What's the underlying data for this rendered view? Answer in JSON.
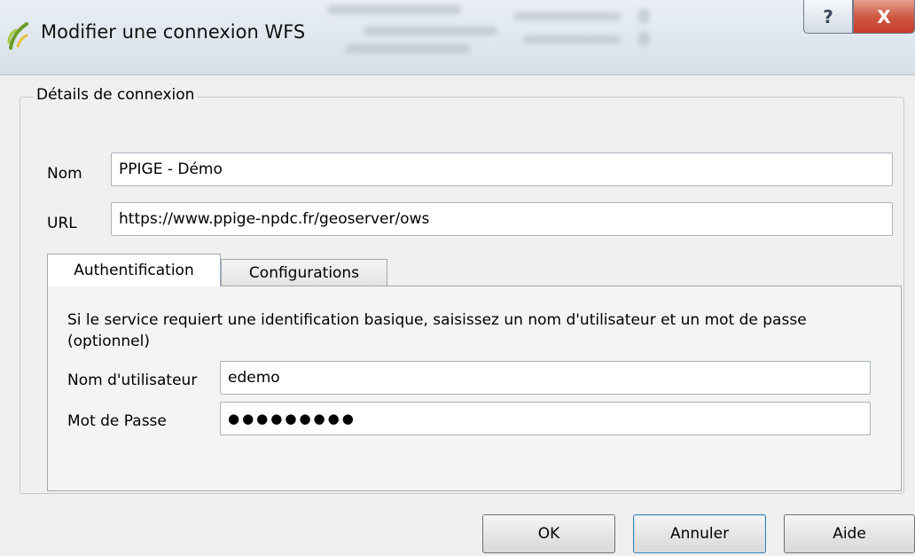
{
  "window": {
    "title": "Modifier une connexion WFS",
    "help_label": "?",
    "close_label": "X"
  },
  "group": {
    "title": "Détails de connexion",
    "name_label": "Nom",
    "name_value": "PPIGE - Démo",
    "url_label": "URL",
    "url_value": "https://www.ppige-npdc.fr/geoserver/ows"
  },
  "tabs": [
    {
      "label": "Authentification",
      "active": true
    },
    {
      "label": "Configurations",
      "active": false
    }
  ],
  "auth": {
    "description": "Si le service requiert une identification basique, saisissez un nom d'utilisateur et un mot de passe (optionnel)",
    "username_label": "Nom d'utilisateur",
    "username_value": "edemo",
    "password_label": "Mot de Passe",
    "password_masked": "●●●●●●●●●"
  },
  "buttons": {
    "ok": "OK",
    "cancel": "Annuler",
    "help": "Aide"
  },
  "colors": {
    "titlebar": "#dfe6ee",
    "close_button": "#c43c27",
    "dialog_background": "#f0f0f0",
    "focus_border": "#3c7fb1"
  },
  "icons": {
    "app": "qgis-icon",
    "help": "question-icon",
    "close": "close-icon"
  }
}
